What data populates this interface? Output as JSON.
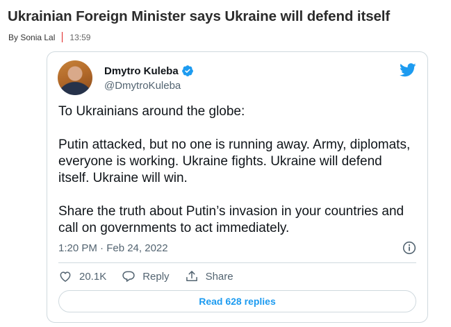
{
  "article": {
    "headline": "Ukrainian Foreign Minister says Ukraine will defend itself",
    "byline": "By Sonia Lal",
    "time": "13:59"
  },
  "tweet": {
    "display_name": "Dmytro Kuleba",
    "handle": "@DmytroKuleba",
    "verified": true,
    "paragraphs": [
      "To Ukrainians around the globe:",
      "Putin attacked, but no one is running away. Army, diplomats, everyone is working. Ukraine fights. Ukraine will defend itself. Ukraine will win.",
      "Share the truth about Putin’s invasion in your countries and call on governments to act immediately."
    ],
    "timestamp": "1:20 PM · Feb 24, 2022",
    "actions": {
      "likes": "20.1K",
      "reply_label": "Reply",
      "share_label": "Share"
    },
    "read_replies_label": "Read 628 replies"
  },
  "icons": {
    "avatar": "avatar",
    "verified": "verified-badge-icon",
    "logo": "twitter-bird-icon",
    "info": "info-icon",
    "like": "heart-icon",
    "reply": "speech-bubble-icon",
    "share": "share-upload-icon"
  },
  "colors": {
    "accent": "#1d9bf0",
    "byline_separator": "#e02020",
    "secondary_text": "#536471",
    "border": "#cfd9de"
  }
}
